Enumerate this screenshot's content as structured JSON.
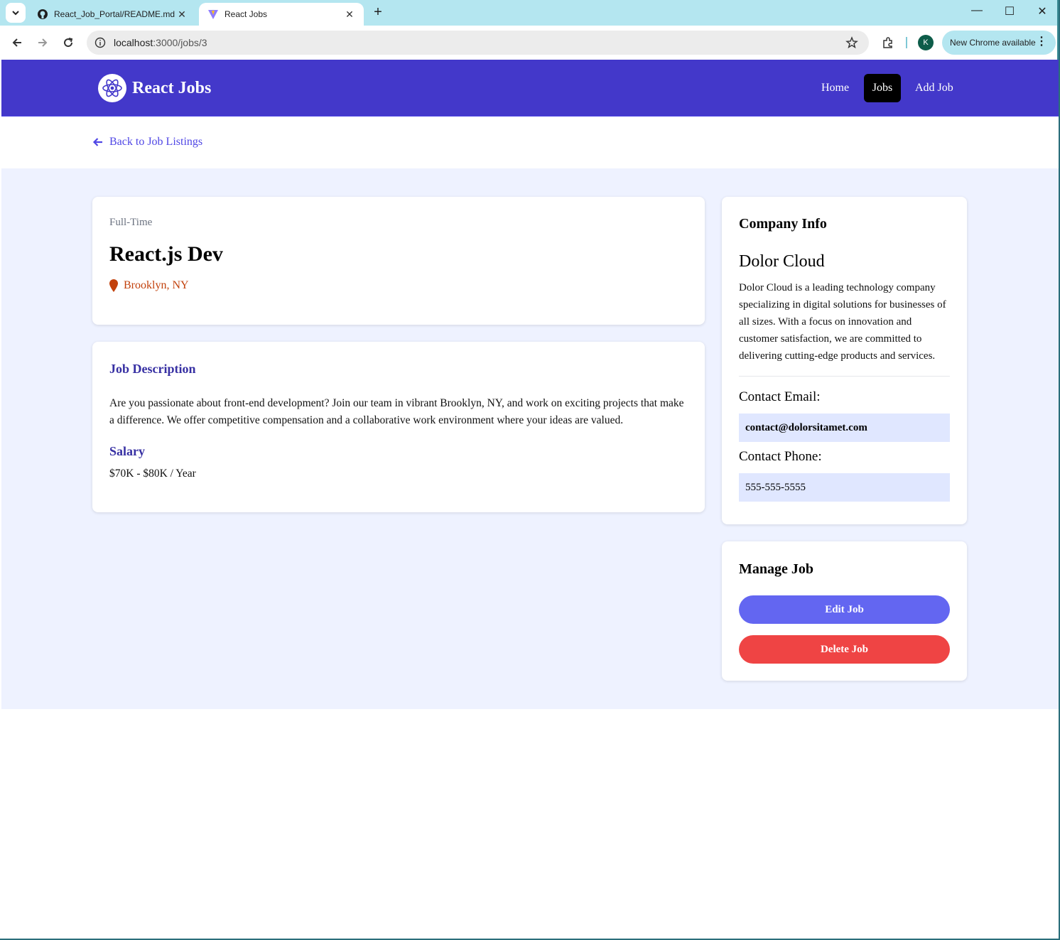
{
  "browser": {
    "tabs": [
      {
        "title": "React_Job_Portal/README.md a",
        "icon": "github-icon",
        "active": false
      },
      {
        "title": "React Jobs",
        "icon": "vite-icon",
        "active": true
      }
    ],
    "url_host": "localhost",
    "url_path": ":3000/jobs/3",
    "profile_initial": "K",
    "update_label": "New Chrome available"
  },
  "navbar": {
    "brand": "React Jobs",
    "links": [
      {
        "label": "Home",
        "active": false
      },
      {
        "label": "Jobs",
        "active": true
      },
      {
        "label": "Add Job",
        "active": false
      }
    ]
  },
  "back_link": "Back to Job Listings",
  "job": {
    "type": "Full-Time",
    "title": "React.js Dev",
    "location": "Brooklyn, NY",
    "description_heading": "Job Description",
    "description": "Are you passionate about front-end development? Join our team in vibrant Brooklyn, NY, and work on exciting projects that make a difference. We offer competitive compensation and a collaborative work environment where your ideas are valued.",
    "salary_heading": "Salary",
    "salary": "$70K - $80K / Year"
  },
  "company": {
    "heading": "Company Info",
    "name": "Dolor Cloud",
    "description": "Dolor Cloud is a leading technology company specializing in digital solutions for businesses of all sizes. With a focus on innovation and customer satisfaction, we are committed to delivering cutting-edge products and services.",
    "email_label": "Contact Email:",
    "email": "contact@dolorsitamet.com",
    "phone_label": "Contact Phone:",
    "phone": "555-555-5555"
  },
  "manage": {
    "heading": "Manage Job",
    "edit_label": "Edit Job",
    "delete_label": "Delete Job"
  },
  "colors": {
    "navbar": "#4338ca",
    "accent": "#4f46e5",
    "page_bg": "#eef2ff",
    "location": "#c2410c",
    "edit_button": "#6366f1",
    "delete_button": "#ef4444"
  }
}
